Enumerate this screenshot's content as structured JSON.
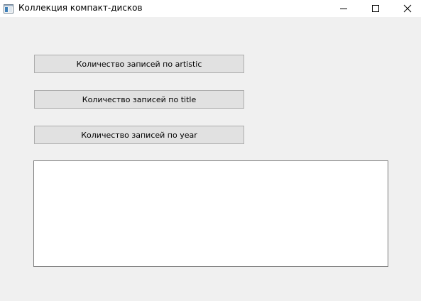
{
  "window": {
    "title": "Коллекция компакт-дисков"
  },
  "buttons": {
    "count_artistic": "Количество записей по artistic",
    "count_title": "Количество записей по title",
    "count_year": "Количество записей по year"
  },
  "output": {
    "text": ""
  },
  "icons": {
    "app": "app-window-icon",
    "minimize": "minimize-icon",
    "maximize": "maximize-icon",
    "close": "close-icon"
  },
  "colors": {
    "background": "#f0f0f0",
    "button_face": "#e1e1e1",
    "button_border": "#adadad",
    "text_area_border": "#7a7a7a"
  }
}
